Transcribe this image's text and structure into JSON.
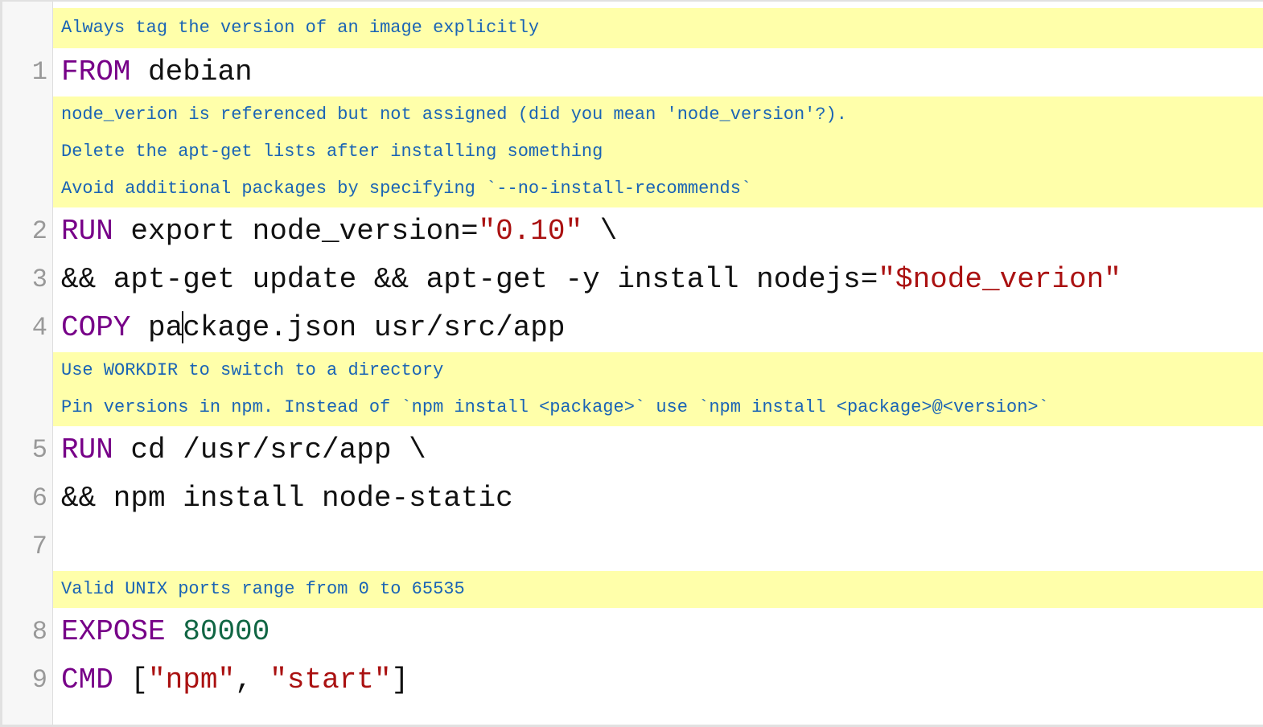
{
  "editor": {
    "rows": [
      {
        "kind": "warning",
        "text": "Always tag the version of an image explicitly"
      },
      {
        "kind": "code",
        "n": "1",
        "tokens": [
          {
            "t": "kw",
            "v": "FROM"
          },
          {
            "t": "p",
            "v": " debian"
          }
        ]
      },
      {
        "kind": "warning",
        "text": "node_verion is referenced but not assigned (did you mean 'node_version'?)."
      },
      {
        "kind": "warning",
        "text": "Delete the apt-get lists after installing something"
      },
      {
        "kind": "warning",
        "text": "Avoid additional packages by specifying `--no-install-recommends`"
      },
      {
        "kind": "code",
        "n": "2",
        "tokens": [
          {
            "t": "kw",
            "v": "RUN"
          },
          {
            "t": "p",
            "v": " export node_version="
          },
          {
            "t": "str",
            "v": "\"0.10\""
          },
          {
            "t": "p",
            "v": " \\"
          }
        ]
      },
      {
        "kind": "code",
        "n": "3",
        "tokens": [
          {
            "t": "p",
            "v": "&& apt-get update && apt-get -y install nodejs="
          },
          {
            "t": "str",
            "v": "\"$node_verion\""
          }
        ]
      },
      {
        "kind": "code",
        "n": "4",
        "tokens": [
          {
            "t": "kw",
            "v": "COPY"
          },
          {
            "t": "p",
            "v": " pa"
          },
          {
            "t": "caret",
            "v": ""
          },
          {
            "t": "p",
            "v": "ckage.json usr/src/app"
          }
        ]
      },
      {
        "kind": "warning",
        "text": "Use WORKDIR to switch to a directory"
      },
      {
        "kind": "warning",
        "text": "Pin versions in npm. Instead of `npm install <package>` use `npm install <package>@<version>`"
      },
      {
        "kind": "code",
        "n": "5",
        "tokens": [
          {
            "t": "kw",
            "v": "RUN"
          },
          {
            "t": "p",
            "v": " cd /usr/src/app \\"
          }
        ]
      },
      {
        "kind": "code",
        "n": "6",
        "tokens": [
          {
            "t": "p",
            "v": "&& npm install node-static"
          }
        ]
      },
      {
        "kind": "code",
        "n": "7",
        "tokens": []
      },
      {
        "kind": "warning",
        "text": "Valid UNIX ports range from 0 to 65535"
      },
      {
        "kind": "code",
        "n": "8",
        "tokens": [
          {
            "t": "kw",
            "v": "EXPOSE"
          },
          {
            "t": "p",
            "v": " "
          },
          {
            "t": "num",
            "v": "80000"
          }
        ]
      },
      {
        "kind": "code",
        "n": "9",
        "tokens": [
          {
            "t": "kw",
            "v": "CMD"
          },
          {
            "t": "p",
            "v": " ["
          },
          {
            "t": "str",
            "v": "\"npm\""
          },
          {
            "t": "p",
            "v": ", "
          },
          {
            "t": "str",
            "v": "\"start\""
          },
          {
            "t": "p",
            "v": "]"
          }
        ]
      }
    ]
  },
  "colors": {
    "keyword": "#770088",
    "string": "#aa1111",
    "number": "#116644",
    "warning_bg": "#ffffaa",
    "warning_text": "#1a64b5",
    "gutter_bg": "#f7f7f7"
  }
}
